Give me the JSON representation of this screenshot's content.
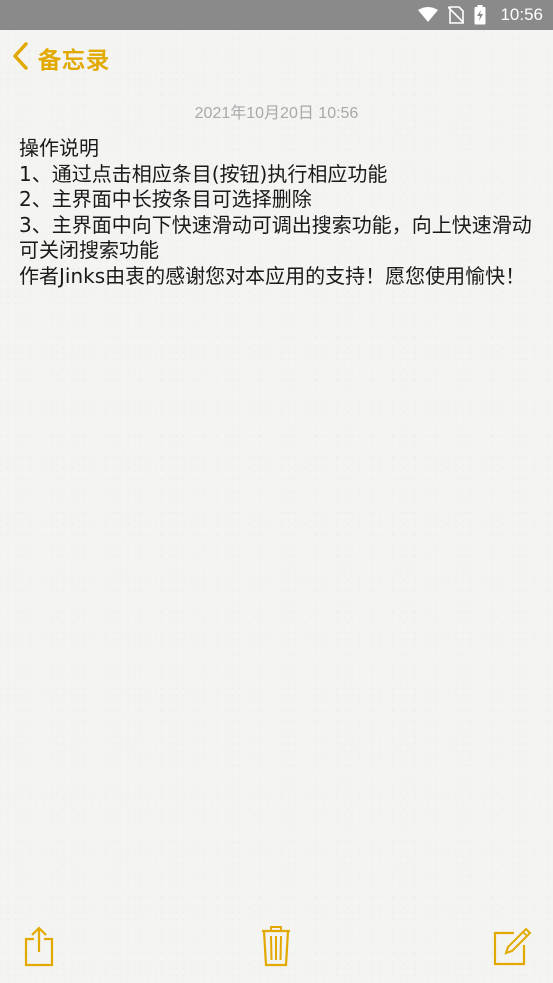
{
  "status_bar": {
    "time": "10:56",
    "icons": [
      "wifi-icon",
      "no-sim-icon",
      "battery-charging-icon"
    ]
  },
  "nav": {
    "back_label": "备忘录",
    "accent_color": "#e2a900"
  },
  "note": {
    "date": "2021年10月20日 10:56",
    "content": "操作说明\n1、通过点击相应条目(按钮)执行相应功能\n2、主界面中长按条目可选择删除\n3、主界面中向下快速滑动可调出搜索功能，向上快速滑动可关闭搜索功能\n作者Jinks由衷的感谢您对本应用的支持！愿您使用愉快！"
  },
  "toolbar": {
    "icons": [
      "share-icon",
      "trash-icon",
      "compose-icon"
    ]
  }
}
